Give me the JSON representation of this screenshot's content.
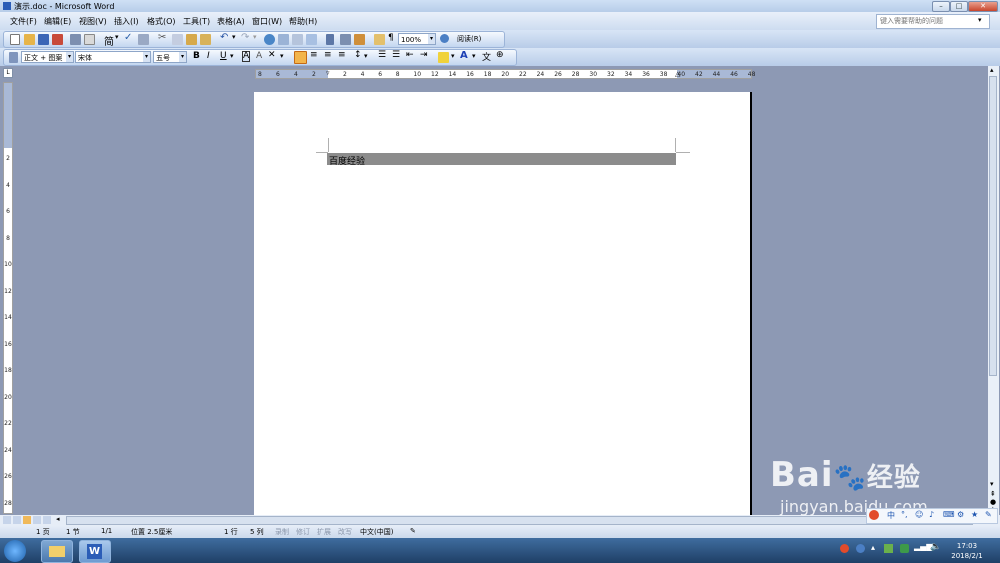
{
  "window": {
    "title": "演示.doc - Microsoft Word"
  },
  "menu": {
    "items": [
      "文件(F)",
      "编辑(E)",
      "视图(V)",
      "插入(I)",
      "格式(O)",
      "工具(T)",
      "表格(A)",
      "窗口(W)",
      "帮助(H)"
    ]
  },
  "help": {
    "placeholder": "键入需要帮助的问题"
  },
  "toolbar": {
    "zoom": "100%",
    "read_label": "阅读(R)",
    "trad_simp": "简"
  },
  "formatting": {
    "style": "正文 + 图案",
    "font": "宋体",
    "size": "五号"
  },
  "ruler": {
    "h_left": [
      "8",
      "6",
      "4",
      "2"
    ],
    "h_right": [
      "2",
      "4",
      "6",
      "8",
      "10",
      "12",
      "14",
      "16",
      "18",
      "20",
      "22",
      "24",
      "26",
      "28",
      "30",
      "32",
      "34",
      "36",
      "38",
      "40",
      "42",
      "44",
      "46",
      "48"
    ],
    "v_labels": [
      "2",
      "4",
      "6",
      "8",
      "10",
      "12",
      "14",
      "16",
      "18",
      "20",
      "22",
      "24",
      "26",
      "28"
    ]
  },
  "document": {
    "text": "百度经验"
  },
  "status": {
    "page": "1 页",
    "section": "1 节",
    "pages": "1/1",
    "position": "位置 2.5厘米",
    "line": "1 行",
    "col": "5 列",
    "rec": "录制",
    "trk": "修订",
    "ext": "扩展",
    "ovr": "改写",
    "lang": "中文(中国)"
  },
  "taskbar": {
    "time": "17:03",
    "date": "2018/2/1"
  },
  "watermark": {
    "brand": "Bai",
    "brand2": "经验",
    "url": "jingyan.baidu.com"
  },
  "ime": {
    "label": "中"
  }
}
